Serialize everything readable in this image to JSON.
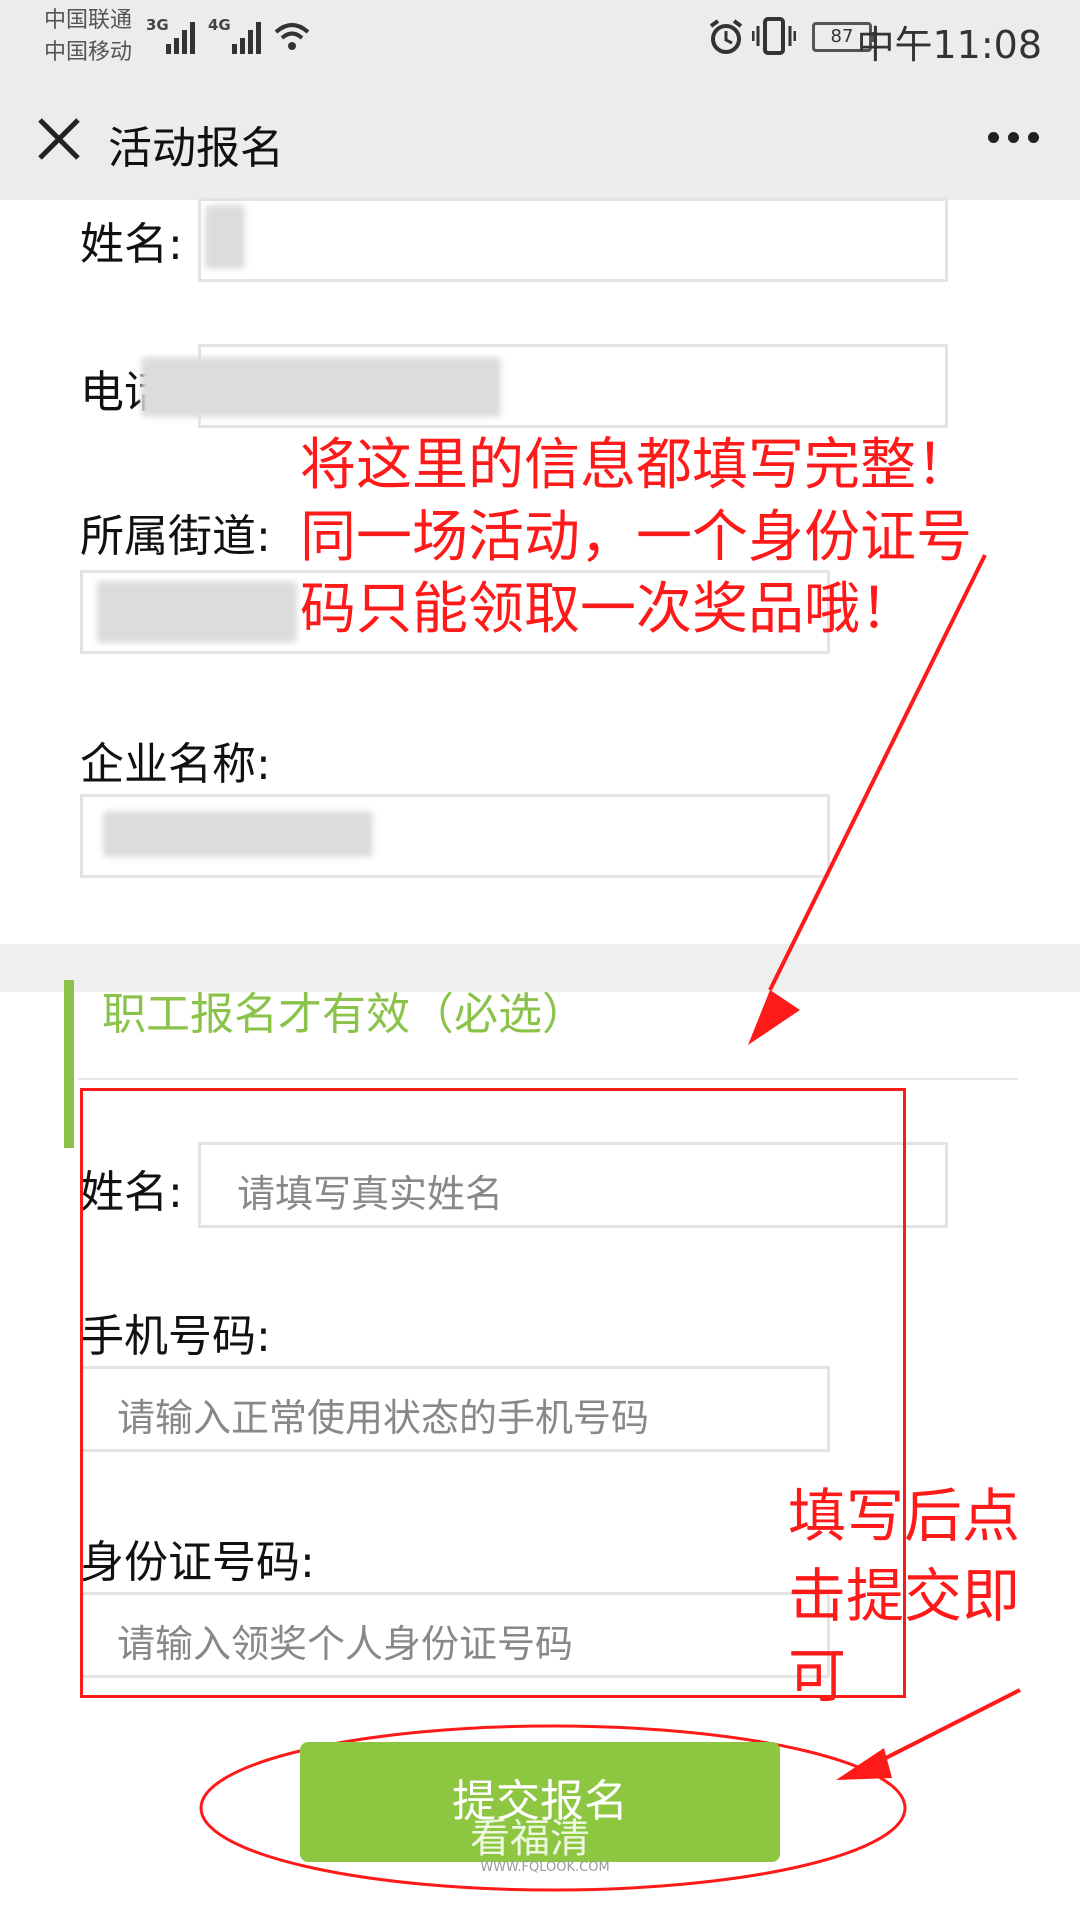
{
  "status_bar": {
    "carrier1": "中国联通",
    "carrier2": "中国移动",
    "net1": "3G",
    "net2": "4G",
    "battery": "87",
    "time": "中午11:08"
  },
  "titlebar": {
    "title": "活动报名",
    "close_icon": "close-icon",
    "more_icon": "more-icon"
  },
  "form_top": {
    "name_label": "姓名:",
    "phone_label": "电话",
    "street_label": "所属街道:",
    "company_label": "企业名称:"
  },
  "section": {
    "title": "职工报名才有效（必选）"
  },
  "form_bottom": {
    "name_label": "姓名:",
    "name_placeholder": "请填写真实姓名",
    "phone_label": "手机号码:",
    "phone_placeholder": "请输入正常使用状态的手机号码",
    "id_label": "身份证号码:",
    "id_placeholder": "请输入领奖个人身份证号码"
  },
  "annotations": {
    "top_note_line1": "将这里的信息都填写完整！",
    "top_note_line2": "同一场活动，一个身份证号",
    "top_note_line3": "码只能领取一次奖品哦！",
    "bottom_note_line1": "填写后点",
    "bottom_note_line2": "击提交即",
    "bottom_note_line3": "可"
  },
  "submit": {
    "label": "提交报名"
  },
  "watermark": {
    "main": "看福清",
    "small": "WWW.FQLOOK.COM"
  },
  "colors": {
    "accent": "#8bc34a",
    "annotation": "#ff1a1a",
    "button": "#8dc641"
  }
}
